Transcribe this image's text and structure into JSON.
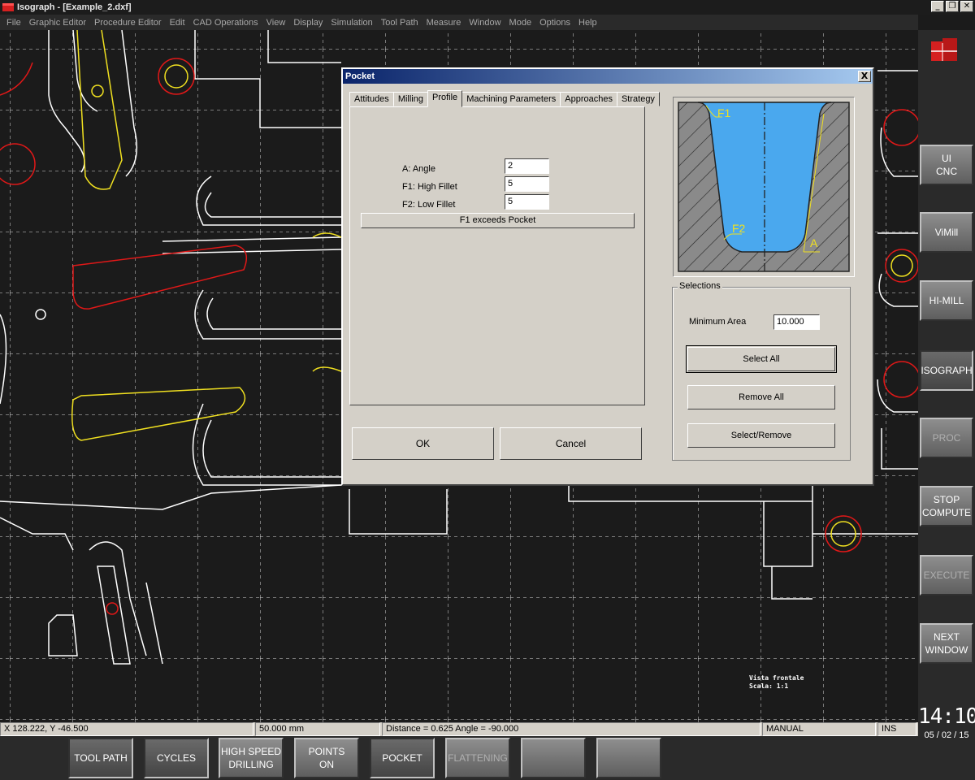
{
  "window": {
    "title": "Isograph - [Example_2.dxf]"
  },
  "menu": [
    "File",
    "Graphic Editor",
    "Procedure Editor",
    "Edit",
    "CAD Operations",
    "View",
    "Display",
    "Simulation",
    "Tool Path",
    "Measure",
    "Window",
    "Mode",
    "Options",
    "Help"
  ],
  "canvas": {
    "note_line1": "Vista frontale",
    "note_line2": "Scala: 1:1"
  },
  "side_buttons": [
    {
      "label": "UI\nCNC",
      "state": "normal"
    },
    {
      "label": "ViMill",
      "state": "normal"
    },
    {
      "label": "HI-MILL",
      "state": "normal"
    },
    {
      "label": "ISOGRAPH",
      "state": "active"
    },
    {
      "label": "PROC",
      "state": "disabled"
    },
    {
      "label": "STOP\nCOMPUTE",
      "state": "normal"
    },
    {
      "label": "EXECUTE",
      "state": "disabled"
    },
    {
      "label": "NEXT\nWINDOW",
      "state": "normal"
    }
  ],
  "clock": {
    "time": "14:10",
    "date": "05 / 02 / 15"
  },
  "status": {
    "coords": "X 128.222, Y -46.500",
    "grid": "50.000 mm",
    "measure": "Distance = 0.625 Angle = -90.000",
    "mode": "MANUAL",
    "ins": "INS"
  },
  "bottom_buttons": [
    {
      "label": "TOOL PATH",
      "state": "active"
    },
    {
      "label": "CYCLES",
      "state": "active"
    },
    {
      "label": "HIGH SPEED\nDRILLING",
      "state": "normal"
    },
    {
      "label": "POINTS\nON",
      "state": "normal"
    },
    {
      "label": "POCKET",
      "state": "active"
    },
    {
      "label": "FLATTENING",
      "state": "disabled"
    },
    {
      "label": "",
      "state": "normal"
    },
    {
      "label": "",
      "state": "normal"
    }
  ],
  "dialog": {
    "title": "Pocket",
    "close": "X",
    "tabs": [
      "Attitudes",
      "Milling",
      "Profile",
      "Machining Parameters",
      "Approaches",
      "Strategy"
    ],
    "active_tab": "Profile",
    "fields": [
      {
        "label": "A: Angle",
        "value": "2"
      },
      {
        "label": "F1: High Fillet",
        "value": "5"
      },
      {
        "label": "F2: Low Fillet",
        "value": "5"
      }
    ],
    "warning": "F1 exceeds Pocket",
    "ok": "OK",
    "cancel": "Cancel",
    "preview_labels": {
      "f1": "F1",
      "f2": "F2",
      "a": "A"
    },
    "selections": {
      "legend": "Selections",
      "min_area_label": "Minimum Area",
      "min_area_value": "10.000",
      "select_all": "Select All",
      "remove_all": "Remove All",
      "select_remove": "Select/Remove"
    }
  },
  "colors": {
    "pocket_fill": "#4aa8ee",
    "cad_yellow": "#f0e020",
    "cad_red": "#e01818",
    "cad_white": "#ffffff"
  }
}
